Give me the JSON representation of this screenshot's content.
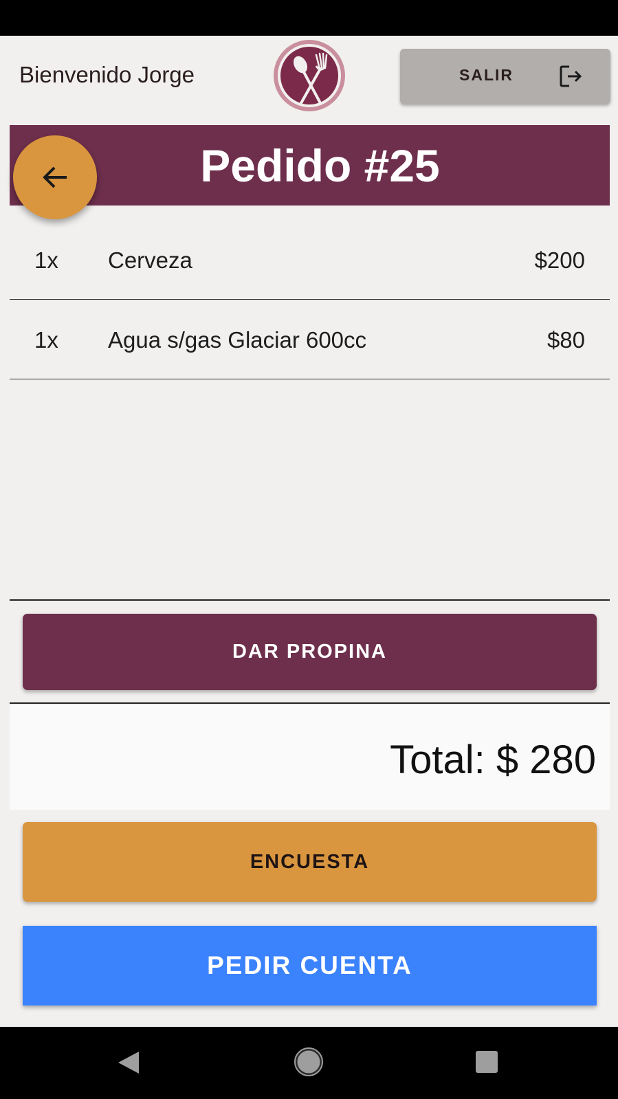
{
  "header": {
    "welcome": "Bienvenido Jorge",
    "logo_icon": "cutlery-logo-icon",
    "logout_label": "SALIR",
    "logout_icon": "logout-icon"
  },
  "order": {
    "title": "Pedido #25",
    "back_icon": "arrow-left-icon",
    "items": [
      {
        "qty": "1x",
        "name": "Cerveza",
        "price": "$200"
      },
      {
        "qty": "1x",
        "name": "Agua s/gas Glaciar 600cc",
        "price": "$80"
      }
    ]
  },
  "actions": {
    "tip_label": "DAR PROPINA",
    "total_label": "Total: $ 280",
    "survey_label": "ENCUESTA",
    "bill_label": "PEDIR CUENTA"
  },
  "colors": {
    "primary": "#6e2f4c",
    "accent": "#d9963f",
    "blue": "#3b82fd",
    "background": "#f2f0ef",
    "logout_bg": "#b2aeac"
  },
  "system_nav": {
    "back_icon": "nav-back-triangle-icon",
    "home_icon": "nav-home-circle-icon",
    "recents_icon": "nav-recents-square-icon"
  }
}
